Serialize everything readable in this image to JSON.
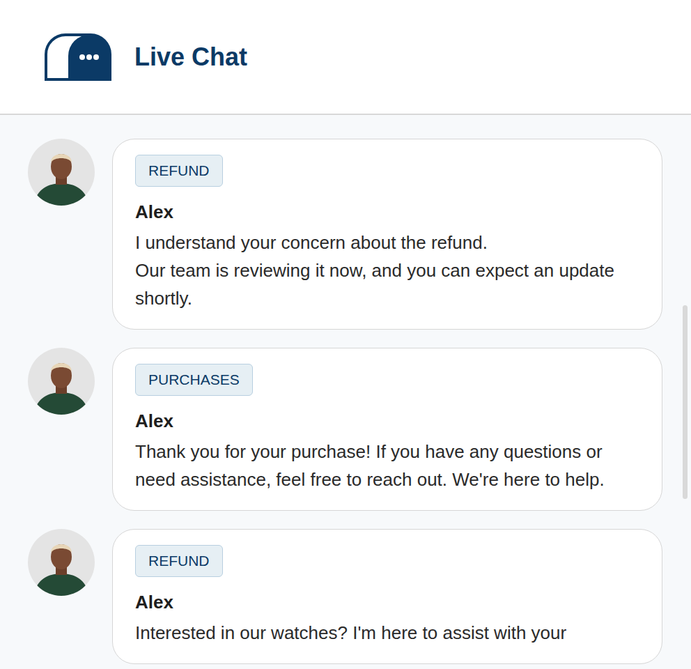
{
  "header": {
    "title": "Live Chat"
  },
  "messages": [
    {
      "tag": "REFUND",
      "author": "Alex",
      "text": "I understand your concern about the refund.\nOur team is reviewing it now, and you can expect an update shortly."
    },
    {
      "tag": "PURCHASES",
      "author": "Alex",
      "text": "Thank you for your purchase! If you have any questions or need assistance, feel free to reach out. We're here to help."
    },
    {
      "tag": "REFUND",
      "author": "Alex",
      "text": "Interested in our watches? I'm here to assist with your"
    }
  ]
}
